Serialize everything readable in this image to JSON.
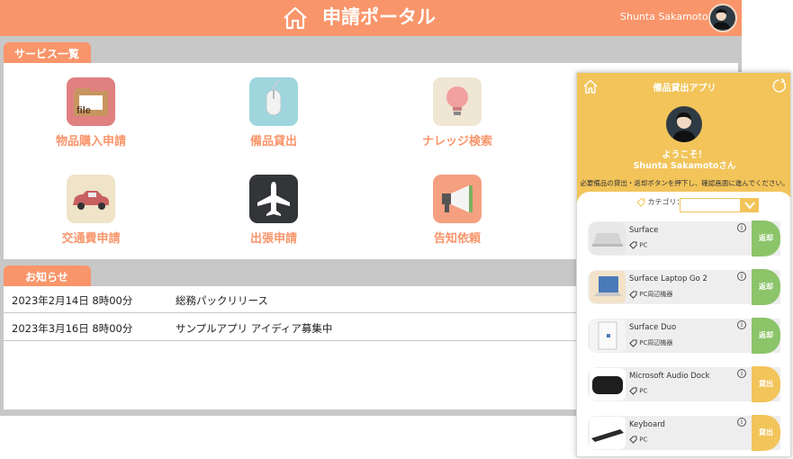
{
  "portal": {
    "title": "申請ポータル",
    "user_name": "Shunta Sakamoto",
    "services_tab": "サービス一覧",
    "services": [
      {
        "label": "物品購入申請",
        "icon": "file-folder-icon"
      },
      {
        "label": "備品貸出",
        "icon": "mouse-icon"
      },
      {
        "label": "ナレッジ検索",
        "icon": "lightbulb-icon"
      },
      {
        "label": "交通費申請",
        "icon": "car-icon"
      },
      {
        "label": "出張申請",
        "icon": "airplane-icon"
      },
      {
        "label": "告知依頼",
        "icon": "megaphone-icon"
      }
    ],
    "news_tab": "お知らせ",
    "news": [
      {
        "date": "2023年2月14日 8時00分",
        "title": "総務パックリリース"
      },
      {
        "date": "2023年3月16日 8時00分",
        "title": "サンプルアプリ アイディア募集中"
      }
    ]
  },
  "app": {
    "title": "備品貸出アプリ",
    "welcome": "ようこそ！",
    "user_line": "Shunta Sakamotoさん",
    "note": "必要備品の貸出・返却ボタンを押下し、確認画面に進んでください。",
    "category_label": "カテゴリ：",
    "category_value": "",
    "items": [
      {
        "name": "Surface",
        "category": "PC",
        "action": "返却",
        "action_type": "return"
      },
      {
        "name": "Surface Laptop Go 2",
        "category": "PC周辺機器",
        "action": "返却",
        "action_type": "return"
      },
      {
        "name": "Surface Duo",
        "category": "PC周辺機器",
        "action": "返却",
        "action_type": "return"
      },
      {
        "name": "Microsoft Audio Dock",
        "category": "PC",
        "action": "貸出",
        "action_type": "lend"
      },
      {
        "name": "Keyboard",
        "category": "PC",
        "action": "貸出",
        "action_type": "lend"
      }
    ]
  },
  "colors": {
    "accent": "#f9956a",
    "app_accent": "#f2c45a",
    "return": "#8cc46a"
  }
}
